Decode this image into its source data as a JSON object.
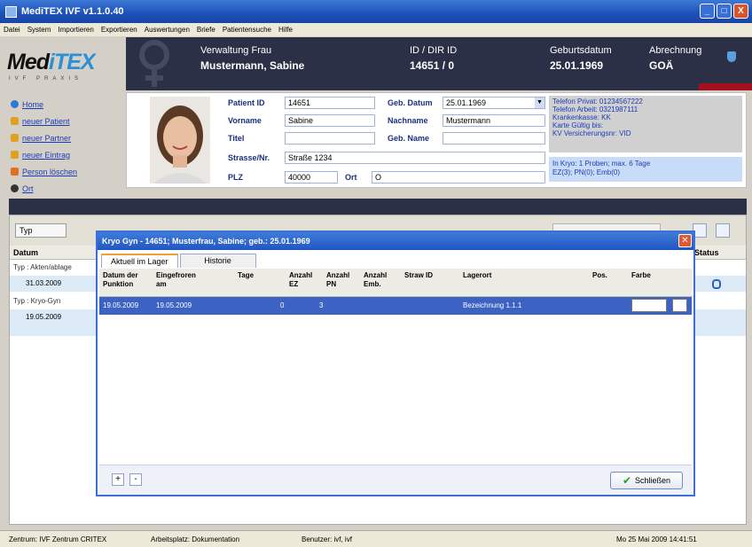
{
  "window": {
    "title": "MediTEX IVF v1.1.0.40",
    "min": "_",
    "max": "□",
    "close": "X"
  },
  "menu": [
    "Datei",
    "System",
    "Importieren",
    "Exportieren",
    "Auswertungen",
    "Briefe",
    "Patientensuche",
    "Hilfe"
  ],
  "logo": {
    "pre": "Med",
    "mid": "iTEX",
    "sub": "IVF PRAXIS"
  },
  "header": {
    "name_label": "Verwaltung Frau",
    "name_value": "Mustermann, Sabine",
    "id_label": "ID / DIR ID",
    "id_value": "14651 / 0",
    "dob_label": "Geburtsdatum",
    "dob_value": "25.01.1969",
    "billing_label": "Abrechnung",
    "billing_value": "GOÄ"
  },
  "nav": [
    "Home",
    "neuer Patient",
    "neuer Partner",
    "neuer Eintrag",
    "Person löschen",
    "Ort"
  ],
  "patient": {
    "labels": {
      "id": "Patient ID",
      "vorname": "Vorname",
      "titel": "Titel",
      "strasse": "Strasse/Nr.",
      "plz": "PLZ",
      "ort": "Ort",
      "gebdatum": "Geb. Datum",
      "nachname": "Nachname",
      "gebname": "Geb. Name"
    },
    "values": {
      "id": "14651",
      "vorname": "Sabine",
      "titel": "",
      "strasse": "Straße 1234",
      "plz": "40000",
      "ort": "O",
      "gebdatum": "25.01.1969",
      "nachname": "Mustermann",
      "gebname": ""
    },
    "info_red": [
      "Telefon Privat: 01234567222",
      "Telefon Arbeit: 0321987111",
      "Krankenkasse: KK",
      "Karte Gültig bis:",
      "KV Versicherungsnr: VID"
    ],
    "info_blue": [
      "In Kryo: 1 Proben; max. 6 Tage",
      "EZ(3); PN(0); Emb(0)"
    ]
  },
  "grid": {
    "typ_select": "Typ",
    "col_datum": "Datum",
    "col_status": "Status",
    "rows": [
      {
        "group": "Typ : Akten/ablage",
        "date": "31.03.2009"
      },
      {
        "group": "Typ : Kryo-Gyn",
        "date": "19.05.2009"
      }
    ]
  },
  "dialog": {
    "title": "Kryo Gyn - 14651; Musterfrau, Sabine; geb.: 25.01.1969",
    "tabs": [
      "Aktuell im Lager",
      "Historie"
    ],
    "columns": [
      "Datum der Punktion",
      "Eingefroren am",
      "Tage",
      "Anzahl EZ",
      "Anzahl PN",
      "Anzahl Emb.",
      "Straw ID",
      "Lagerort",
      "Pos.",
      "Farbe"
    ],
    "row": {
      "datum": "19.05.2009",
      "eingefroren": "19.05.2009",
      "tage": "0",
      "ez": "3",
      "pn": "",
      "emb": "",
      "straw": "",
      "lagerort": "Bezeichnung 1.1.1",
      "pos": ""
    },
    "nav_plus": "+",
    "nav_minus": "-",
    "close_label": "Schließen"
  },
  "status": {
    "zentrum": "Zentrum: IVF Zentrum CRITEX",
    "arbeitsplatz": "Arbeitsplatz: Dokumentation",
    "benutzer": "Benutzer: ivf, ivf",
    "datetime": "Mo 25 Mai 2009 14:41:51"
  },
  "colors": {
    "accent_blue": "#2156c3",
    "header_dark": "#2b3047",
    "header_red": "#a3121c",
    "selected_row": "#3c62c4"
  }
}
